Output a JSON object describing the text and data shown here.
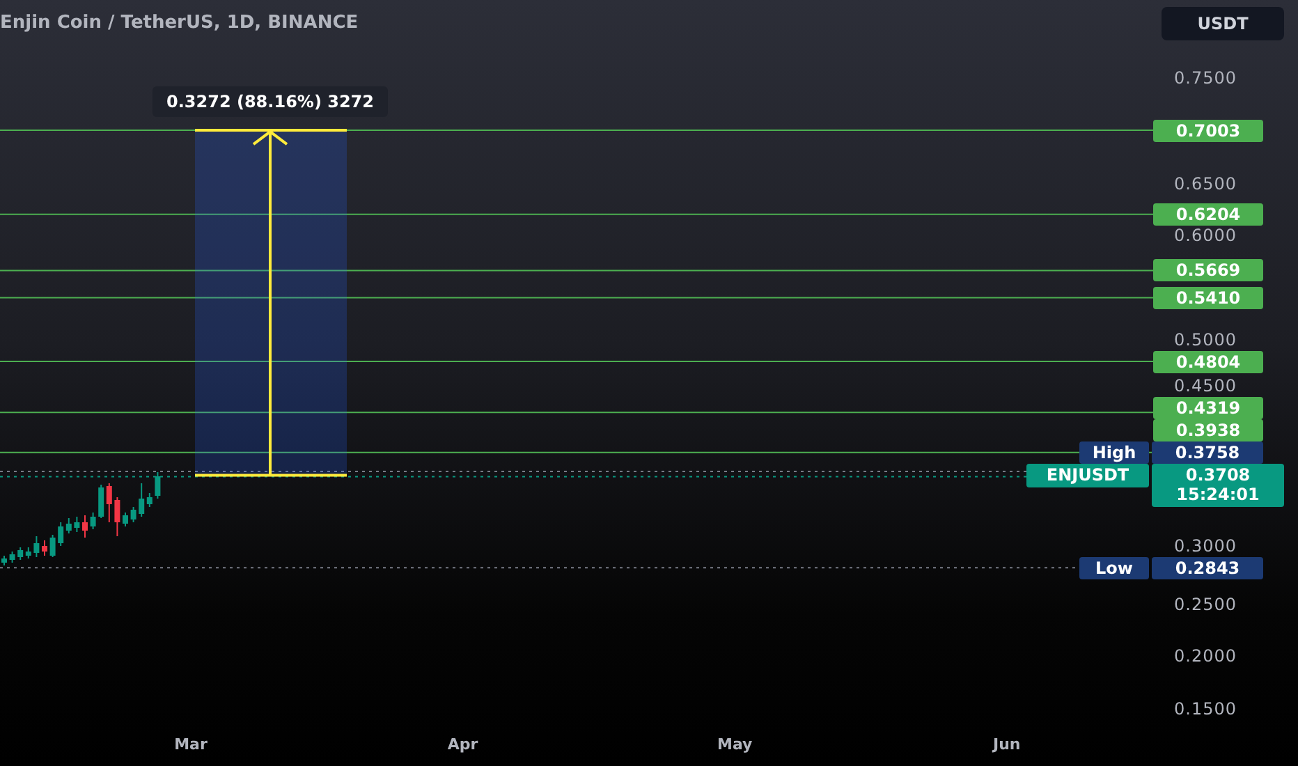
{
  "header": {
    "title": "Enjin Coin / TetherUS, 1D, BINANCE",
    "currency_button": "USDT"
  },
  "price_axis": {
    "ticks": [
      "0.7500",
      "0.6500",
      "0.6000",
      "0.5000",
      "0.4500",
      "0.3000",
      "0.2500",
      "0.2000",
      "0.1500"
    ]
  },
  "time_axis": {
    "ticks": [
      "Mar",
      "Apr",
      "May",
      "Jun"
    ]
  },
  "levels": [
    {
      "price": "0.7003"
    },
    {
      "price": "0.6204"
    },
    {
      "price": "0.5669"
    },
    {
      "price": "0.5410"
    },
    {
      "price": "0.4804"
    },
    {
      "price": "0.4319"
    },
    {
      "price": "0.3938"
    }
  ],
  "high": {
    "label": "High",
    "price": "0.3758"
  },
  "low": {
    "label": "Low",
    "price": "0.2843"
  },
  "last_price": {
    "symbol": "ENJUSDT",
    "price": "0.3708",
    "countdown": "15:24:01"
  },
  "measure": {
    "label": "0.3272 (88.16%) 3272"
  }
}
